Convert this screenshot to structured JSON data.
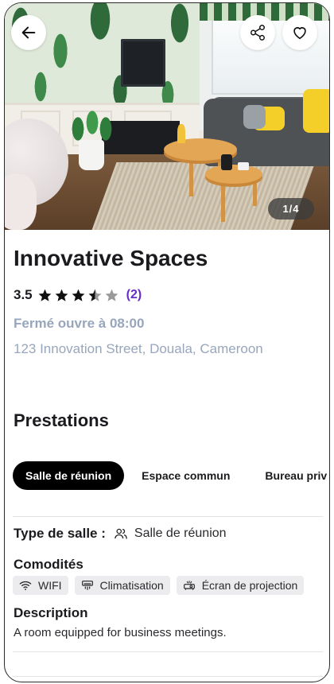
{
  "hero": {
    "image_counter": "1/4"
  },
  "listing": {
    "title": "Innovative Spaces",
    "rating": {
      "value": "3.5",
      "score": 3.5,
      "max": 5,
      "count": "(2)"
    },
    "hours": "Fermé ouvre à 08:00",
    "address": "123 Innovation Street, Douala, Cameroon"
  },
  "prestations": {
    "title": "Prestations",
    "tabs": [
      {
        "label": "Salle de réunion",
        "active": true
      },
      {
        "label": "Espace commun",
        "active": false
      },
      {
        "label": "Bureau privé",
        "active": false
      }
    ]
  },
  "details": {
    "room_type_label": "Type de salle :",
    "room_type_value": "Salle de réunion",
    "amenities_title": "Comodités",
    "amenities": [
      {
        "label": "WIFI",
        "icon": "wifi-icon"
      },
      {
        "label": "Climatisation",
        "icon": "air-conditioner-icon"
      },
      {
        "label": "Écran de projection",
        "icon": "projector-icon"
      }
    ],
    "description_title": "Description",
    "description": "A room equipped for business meetings."
  },
  "colors": {
    "accent_purple": "#6a2cc9",
    "muted_blue_gray": "#98a6bc",
    "active_tab_bg": "#000000",
    "chip_bg": "#ececef"
  },
  "icons": {
    "back": "arrow-left-icon",
    "share": "share-icon",
    "favorite": "heart-icon",
    "star": "star-icon",
    "user_group": "users-icon"
  }
}
